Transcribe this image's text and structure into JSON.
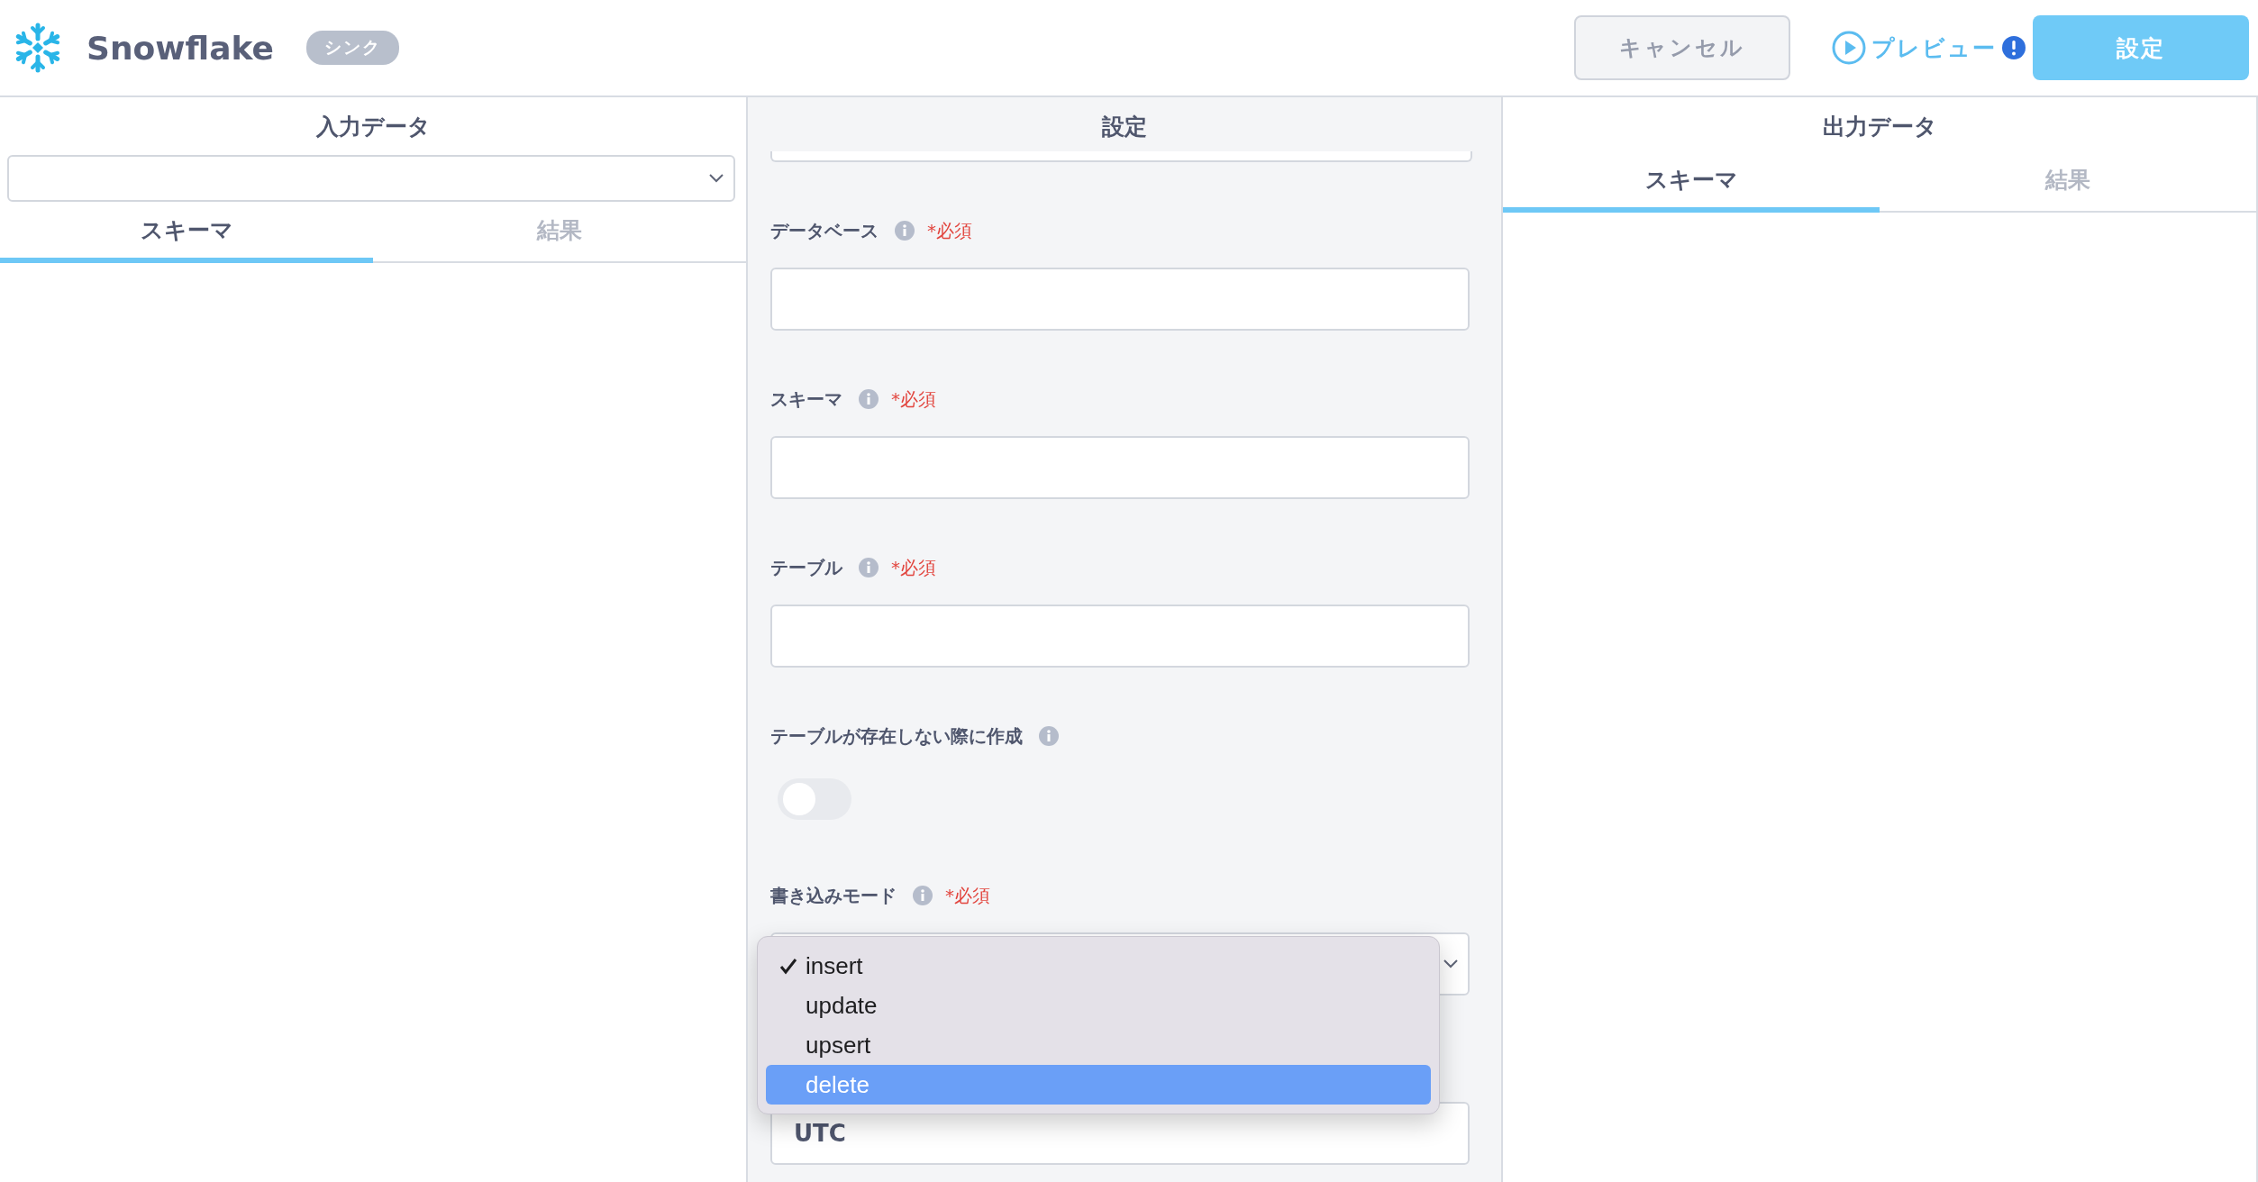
{
  "header": {
    "title": "Snowflake",
    "badge": "シンク",
    "cancel": "キャンセル",
    "preview": "プレビュー",
    "submit": "設定"
  },
  "input_panel": {
    "title": "入力データ",
    "tabs": [
      {
        "label": "スキーマ",
        "selected": true
      },
      {
        "label": "結果",
        "selected": false
      }
    ]
  },
  "settings_panel": {
    "title": "設定",
    "fields": [
      {
        "kind": "text",
        "label": "データベース",
        "required": "*必須"
      },
      {
        "kind": "text",
        "label": "スキーマ",
        "required": "*必須"
      },
      {
        "kind": "text",
        "label": "テーブル",
        "required": "*必須"
      },
      {
        "kind": "toggle",
        "label": "テーブルが存在しない際に作成",
        "on": false
      },
      {
        "kind": "select",
        "label": "書き込みモード",
        "required": "*必須",
        "open": true,
        "options": [
          {
            "label": "insert",
            "checked": true,
            "selected": false
          },
          {
            "label": "update",
            "checked": false,
            "selected": false
          },
          {
            "label": "upsert",
            "checked": false,
            "selected": false
          },
          {
            "label": "delete",
            "checked": false,
            "selected": true
          }
        ]
      },
      {
        "kind": "text",
        "value": "UTC"
      }
    ]
  },
  "output_panel": {
    "title": "出力データ",
    "tabs": [
      {
        "label": "スキーマ",
        "selected": true
      },
      {
        "label": "結果",
        "selected": false
      }
    ]
  }
}
